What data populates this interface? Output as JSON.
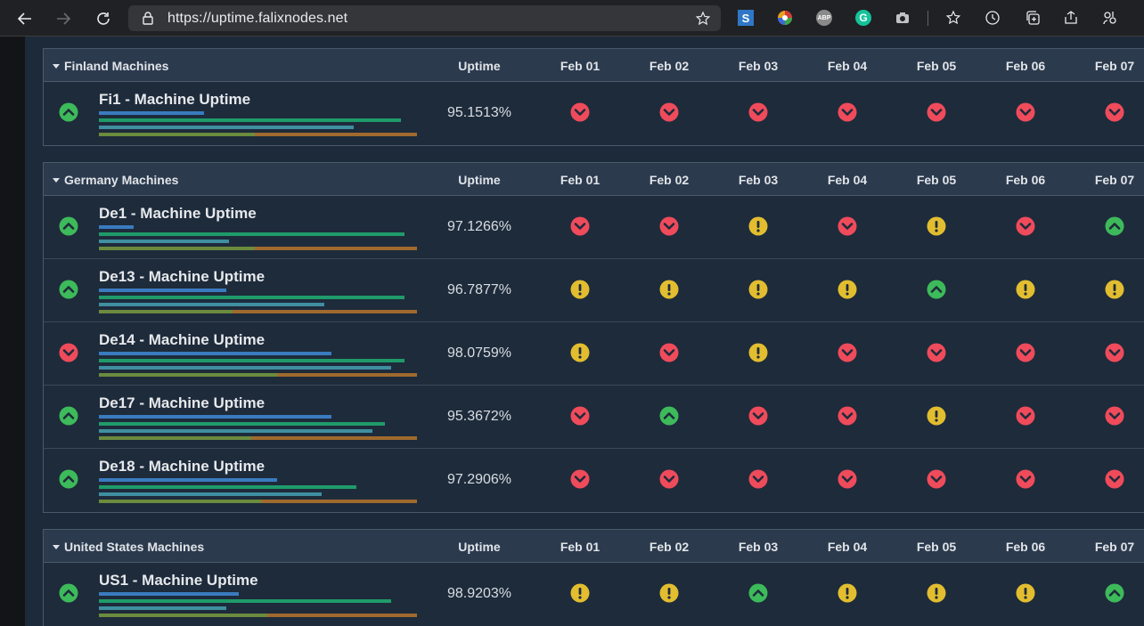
{
  "browser": {
    "url": "https://uptime.falixnodes.net",
    "back_icon": "arrow-left-icon",
    "forward_icon": "arrow-right-icon",
    "refresh_icon": "refresh-icon",
    "extensions": [
      "S",
      "",
      "ABP",
      "G",
      ""
    ]
  },
  "headers": {
    "uptime": "Uptime",
    "days": [
      "Feb 01",
      "Feb 02",
      "Feb 03",
      "Feb 04",
      "Feb 05",
      "Feb 06",
      "Feb 07"
    ]
  },
  "colors": {
    "down": "#ef4b5b",
    "degraded": "#e2bd2f",
    "up": "#3dba5a",
    "bar_blue": "#3a7bbf",
    "bar_green": "#1f9b6a",
    "bar_teal": "#3f8fa0",
    "bar_olive": "#6b8c3e",
    "bar_orange": "#a06a2e"
  },
  "groups": [
    {
      "name": "Finland Machines",
      "machines": [
        {
          "name": "Fi1 - Machine Uptime",
          "uptime": "95.1513%",
          "status": "up",
          "days": [
            "down",
            "down",
            "down",
            "down",
            "down",
            "down",
            "down"
          ],
          "bars": [
            0.33,
            0.95,
            0.8,
            0.49
          ]
        }
      ]
    },
    {
      "name": "Germany Machines",
      "machines": [
        {
          "name": "De1 - Machine Uptime",
          "uptime": "97.1266%",
          "status": "up",
          "days": [
            "down",
            "down",
            "degraded",
            "down",
            "degraded",
            "down",
            "up"
          ],
          "bars": [
            0.11,
            0.96,
            0.41,
            0.49
          ]
        },
        {
          "name": "De13 - Machine Uptime",
          "uptime": "96.7877%",
          "status": "up",
          "days": [
            "degraded",
            "degraded",
            "degraded",
            "degraded",
            "up",
            "degraded",
            "degraded"
          ],
          "bars": [
            0.4,
            0.96,
            0.71,
            0.42
          ]
        },
        {
          "name": "De14 - Machine Uptime",
          "uptime": "98.0759%",
          "status": "down",
          "days": [
            "degraded",
            "down",
            "degraded",
            "down",
            "down",
            "down",
            "down"
          ],
          "bars": [
            0.73,
            0.96,
            0.92,
            0.56
          ]
        },
        {
          "name": "De17 - Machine Uptime",
          "uptime": "95.3672%",
          "status": "up",
          "days": [
            "down",
            "up",
            "down",
            "down",
            "degraded",
            "down",
            "down"
          ],
          "bars": [
            0.73,
            0.9,
            0.86,
            0.48
          ]
        },
        {
          "name": "De18 - Machine Uptime",
          "uptime": "97.2906%",
          "status": "up",
          "days": [
            "down",
            "down",
            "down",
            "down",
            "down",
            "down",
            "down"
          ],
          "bars": [
            0.56,
            0.81,
            0.7,
            0.51
          ]
        }
      ]
    },
    {
      "name": "United States Machines",
      "machines": [
        {
          "name": "US1 - Machine Uptime",
          "uptime": "98.9203%",
          "status": "up",
          "days": [
            "degraded",
            "degraded",
            "up",
            "degraded",
            "degraded",
            "degraded",
            "up"
          ],
          "bars": [
            0.44,
            0.92,
            0.4,
            0.53
          ]
        }
      ]
    }
  ]
}
